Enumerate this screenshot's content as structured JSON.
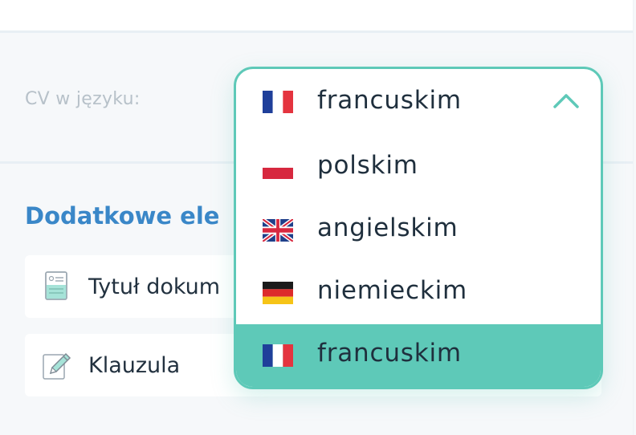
{
  "form": {
    "language_label": "CV w języku:",
    "section_title": "Dodatkowe ele",
    "items": [
      {
        "label": "Tytuł dokum",
        "icon": "document-icon"
      },
      {
        "label": "Klauzula",
        "icon": "pencil-edit-icon"
      }
    ]
  },
  "language_select": {
    "selected": {
      "label": "francuskim",
      "flag": "flag-france-icon"
    },
    "open": true,
    "options": [
      {
        "label": "polskim",
        "flag": "flag-poland-icon",
        "active": false
      },
      {
        "label": "angielskim",
        "flag": "flag-uk-icon",
        "active": false
      },
      {
        "label": "niemieckim",
        "flag": "flag-germany-icon",
        "active": false
      },
      {
        "label": "francuskim",
        "flag": "flag-france-icon",
        "active": true
      }
    ]
  },
  "colors": {
    "accent": "#5ec9b8",
    "title_blue": "#3a87c8",
    "label_gray": "#b7c1c9",
    "text_dark": "#1f2f3d"
  }
}
